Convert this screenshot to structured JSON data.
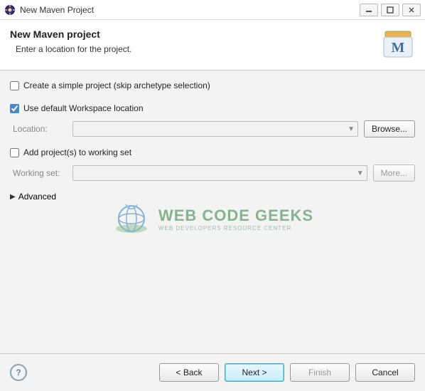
{
  "window": {
    "title": "New Maven Project"
  },
  "header": {
    "title": "New Maven project",
    "subtitle": "Enter a location for the project."
  },
  "content": {
    "simpleProject": {
      "label": "Create a simple project (skip archetype selection)",
      "checked": false
    },
    "defaultWorkspace": {
      "label": "Use default Workspace location",
      "checked": true
    },
    "location": {
      "label": "Location:",
      "value": "",
      "browse": "Browse..."
    },
    "addToWorkingSet": {
      "label": "Add project(s) to working set",
      "checked": false
    },
    "workingSet": {
      "label": "Working set:",
      "value": "",
      "more": "More..."
    },
    "advanced": {
      "label": "Advanced"
    }
  },
  "watermark": {
    "title": "WEB CODE GEEKS",
    "subtitle": "WEB DEVELOPERS RESOURCE CENTER"
  },
  "footer": {
    "back": "< Back",
    "next": "Next >",
    "finish": "Finish",
    "cancel": "Cancel"
  }
}
